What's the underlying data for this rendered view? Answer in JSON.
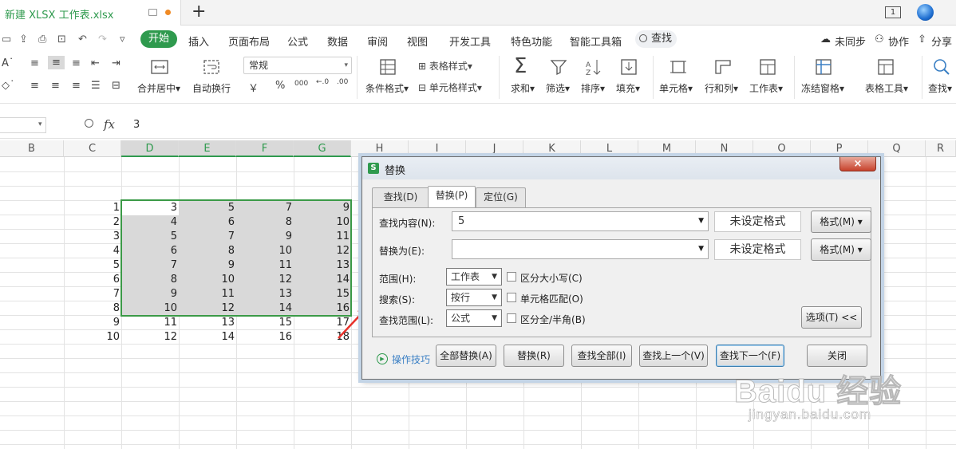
{
  "titlebar": {
    "doc_title": "新建 XLSX 工作表.xlsx",
    "new_tab": "+",
    "right_badge": "1"
  },
  "menu": {
    "active": "开始",
    "items": [
      "插入",
      "页面布局",
      "公式",
      "数据",
      "审阅",
      "视图",
      "开发工具",
      "特色功能",
      "智能工具箱"
    ],
    "search": "查找",
    "right": [
      "未同步",
      "协作",
      "分享"
    ]
  },
  "ribbon": {
    "number_format": "常规",
    "labels": {
      "merge": "合并居中",
      "wrap": "自动换行",
      "cond_fmt": "条件格式",
      "table_style": "表格样式",
      "cell_style": "单元格样式",
      "sum": "求和",
      "filter": "筛选",
      "sort": "排序",
      "fill": "填充",
      "cell": "单元格",
      "rowcol": "行和列",
      "sheet": "工作表",
      "freeze": "冻结窗格",
      "tabletool": "表格工具",
      "find": "查找"
    },
    "symbols": {
      "currency": "￥",
      "percent": "%",
      "thousands": "000"
    }
  },
  "formula": {
    "fx": "fx",
    "value": "3"
  },
  "columns": [
    "B",
    "C",
    "D",
    "E",
    "F",
    "G",
    "H",
    "I",
    "J",
    "K",
    "L",
    "M",
    "N",
    "O",
    "P",
    "Q",
    "R"
  ],
  "rows": [
    [
      "1",
      "3",
      "5",
      "7",
      "9"
    ],
    [
      "2",
      "4",
      "6",
      "8",
      "10"
    ],
    [
      "3",
      "5",
      "7",
      "9",
      "11"
    ],
    [
      "4",
      "6",
      "8",
      "10",
      "12"
    ],
    [
      "5",
      "7",
      "9",
      "11",
      "13"
    ],
    [
      "6",
      "8",
      "10",
      "12",
      "14"
    ],
    [
      "7",
      "9",
      "11",
      "13",
      "15"
    ],
    [
      "8",
      "10",
      "12",
      "14",
      "16"
    ],
    [
      "9",
      "11",
      "13",
      "15",
      "17"
    ],
    [
      "10",
      "12",
      "14",
      "16",
      "18"
    ]
  ],
  "dialog": {
    "title": "替换",
    "logo": "S",
    "close": "×",
    "tabs": [
      "查找(D)",
      "替换(P)",
      "定位(G)"
    ],
    "find_label": "查找内容(N):",
    "find_value": "5",
    "replace_label": "替换为(E):",
    "replace_value": "",
    "no_format": "未设定格式",
    "format_btn": "格式(M)",
    "scope_label": "范围(H):",
    "scope_value": "工作表",
    "search_label": "搜索(S):",
    "search_value": "按行",
    "lookin_label": "查找范围(L):",
    "lookin_value": "公式",
    "match_case": "区分大小写(C)",
    "match_cell": "单元格匹配(O)",
    "match_width": "区分全/半角(B)",
    "options_btn": "选项(T) <<",
    "tips": "操作技巧",
    "buttons": [
      "全部替换(A)",
      "替换(R)",
      "查找全部(I)",
      "查找上一个(V)",
      "查找下一个(F)",
      "关闭"
    ]
  },
  "watermark": {
    "logo": "Baidu 经验",
    "url": "jingyan.baidu.com"
  }
}
